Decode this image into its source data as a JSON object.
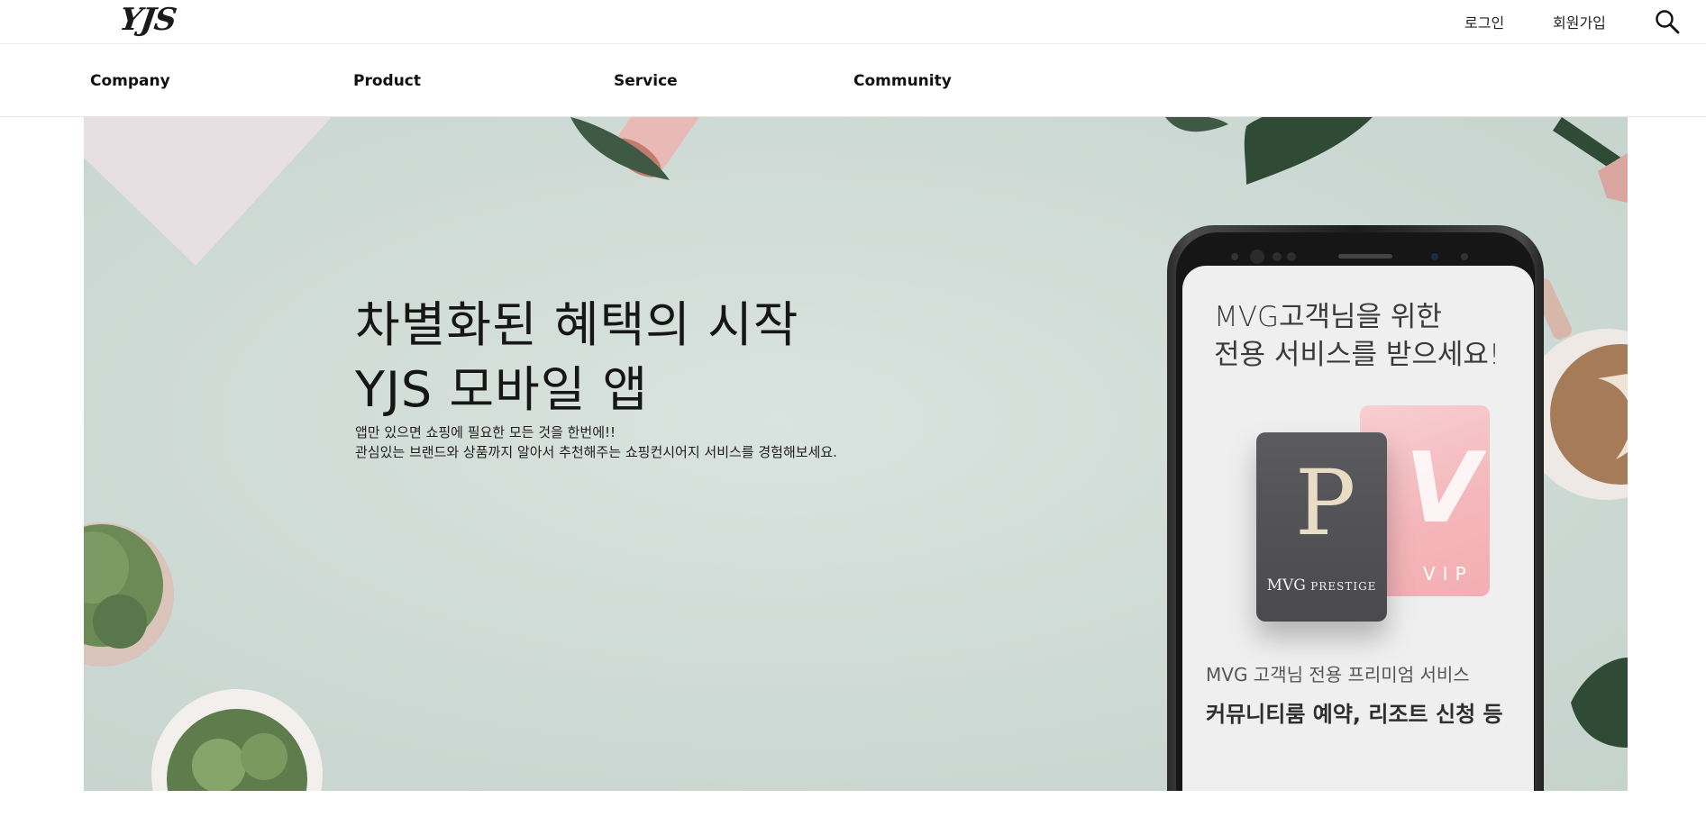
{
  "header": {
    "logo": "YJS",
    "login_label": "로그인",
    "join_label": "회원가입",
    "search_icon": "search-icon"
  },
  "nav": {
    "items": [
      {
        "label": "Company"
      },
      {
        "label": "Product"
      },
      {
        "label": "Service"
      },
      {
        "label": "Community"
      }
    ]
  },
  "hero": {
    "title_line1": "차별화된 혜택의 시작",
    "title_line2": "YJS 모바일 앱",
    "sub_line1": "앱만 있으면 쇼핑에 필요한 모든 것을 한번에!!",
    "sub_line2": "관심있는 브랜드와 상품까지 알아서 추천해주는 쇼핑컨시어지 서비스를 경험해보세요.",
    "phone": {
      "heading_line1": "MVG고객님을 위한",
      "heading_line2": "전용 서비스를 받으세요!",
      "card_front_letter": "P",
      "card_front_name": "MVG",
      "card_front_tier": "PRESTIGE",
      "card_back_letter": "V",
      "card_back_name": "VIP",
      "caption": "MVG 고객님 전용 프리미엄 서비스",
      "caption_bold": "커뮤니티룸 예약, 리조트 신청 등"
    }
  },
  "colors": {
    "hero_background": "#cfdad5",
    "card_pink": "#f4b6ba",
    "card_gray": "#525256"
  }
}
